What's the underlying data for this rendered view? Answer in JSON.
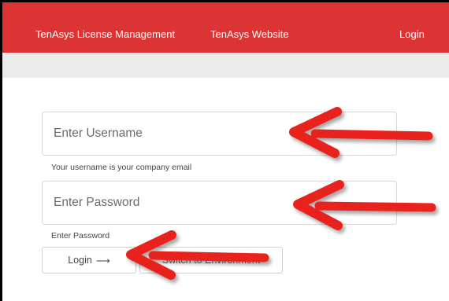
{
  "nav": {
    "brand": "TenAsys License Management",
    "website": "TenAsys Website",
    "login": "Login"
  },
  "form": {
    "username_placeholder": "Enter Username",
    "username_hint": "Your username is your company email",
    "password_placeholder": "Enter Password",
    "password_hint": "Enter Password",
    "login_button": "Login",
    "login_arrow": "⟶",
    "second_button": "Switch to Environment"
  },
  "annotation_color": "#e8231a",
  "brand_color": "#dc3434"
}
